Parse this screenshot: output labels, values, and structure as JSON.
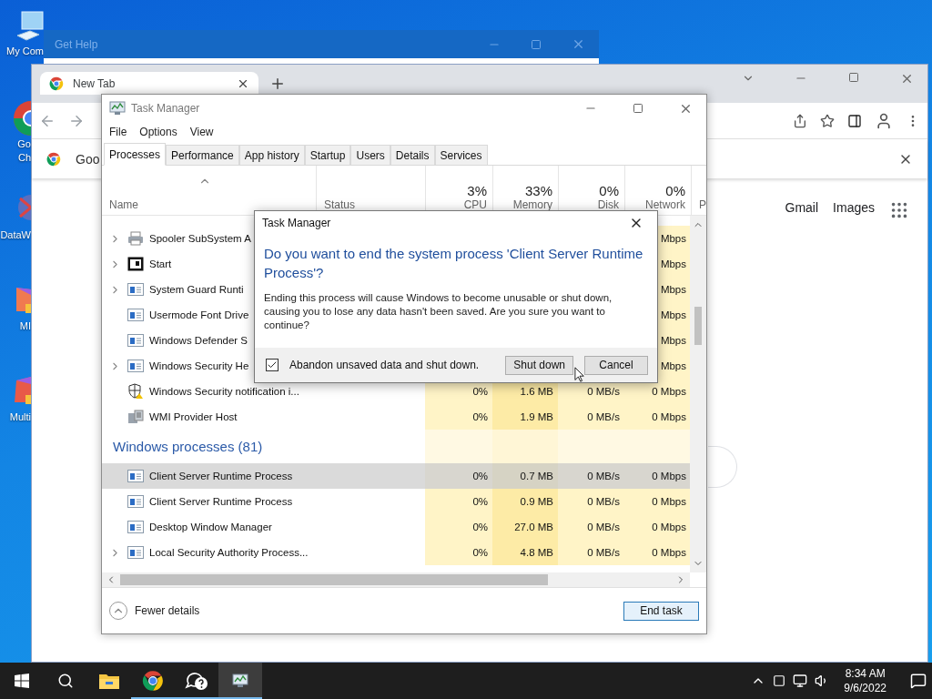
{
  "desktop": {
    "icons": [
      {
        "kind": "computer",
        "lines": [
          "My Com"
        ]
      },
      {
        "kind": "chrome",
        "lines": [
          "Go",
          "Ch"
        ]
      },
      {
        "kind": "dataw",
        "lines": [
          "DataW"
        ]
      },
      {
        "kind": "mi",
        "lines": [
          "MI"
        ]
      },
      {
        "kind": "multi",
        "lines": [
          "Multi"
        ]
      }
    ]
  },
  "get_help": {
    "title": "Get Help"
  },
  "browser": {
    "tab": {
      "title": "New Tab"
    },
    "infobar": {
      "text": "Goo"
    },
    "links": [
      "Gmail",
      "Images"
    ]
  },
  "task_manager": {
    "title": "Task Manager",
    "menu": [
      "File",
      "Options",
      "View"
    ],
    "tabs": [
      {
        "label": "Processes",
        "selected": true
      },
      {
        "label": "Performance",
        "selected": false
      },
      {
        "label": "App history",
        "selected": false
      },
      {
        "label": "Startup",
        "selected": false
      },
      {
        "label": "Users",
        "selected": false
      },
      {
        "label": "Details",
        "selected": false
      },
      {
        "label": "Services",
        "selected": false
      }
    ],
    "columns": [
      {
        "name": "Name"
      },
      {
        "name": "Status"
      },
      {
        "percent": "3%",
        "name": "CPU"
      },
      {
        "percent": "33%",
        "name": "Memory"
      },
      {
        "percent": "0%",
        "name": "Disk"
      },
      {
        "percent": "0%",
        "name": "Network"
      },
      {
        "name": "P"
      }
    ],
    "rows": [
      {
        "kind": "printer",
        "name": "Spooler SubSystem A",
        "expandable": true,
        "selected": false,
        "network": "Mbps"
      },
      {
        "kind": "start",
        "name": "Start",
        "expandable": true,
        "selected": false,
        "network": "Mbps"
      },
      {
        "kind": "app",
        "name": "System Guard Runti",
        "expandable": true,
        "selected": false,
        "network": "Mbps"
      },
      {
        "kind": "app",
        "name": "Usermode Font Drive",
        "expandable": false,
        "selected": false,
        "network": "Mbps"
      },
      {
        "kind": "app",
        "name": "Windows Defender S",
        "expandable": false,
        "selected": false,
        "network": "Mbps"
      },
      {
        "kind": "app",
        "name": "Windows Security He",
        "expandable": true,
        "selected": false,
        "network": "Mbps"
      },
      {
        "kind": "shield",
        "name": "Windows Security notification i...",
        "expandable": false,
        "selected": false,
        "cpu": "0%",
        "memory": "1.6 MB",
        "disk": "0 MB/s",
        "network": "0 Mbps"
      },
      {
        "kind": "wmi",
        "name": "WMI Provider Host",
        "expandable": false,
        "selected": false,
        "cpu": "0%",
        "memory": "1.9 MB",
        "disk": "0 MB/s",
        "network": "0 Mbps"
      },
      {
        "kind": "group",
        "label": "Windows processes (81)"
      },
      {
        "kind": "app",
        "name": "Client Server Runtime Process",
        "expandable": false,
        "selected": true,
        "cpu": "0%",
        "memory": "0.7 MB",
        "disk": "0 MB/s",
        "network": "0 Mbps"
      },
      {
        "kind": "app",
        "name": "Client Server Runtime Process",
        "expandable": false,
        "selected": false,
        "cpu": "0%",
        "memory": "0.9 MB",
        "disk": "0 MB/s",
        "network": "0 Mbps"
      },
      {
        "kind": "app",
        "name": "Desktop Window Manager",
        "expandable": false,
        "selected": false,
        "cpu": "0%",
        "memory": "27.0 MB",
        "disk": "0 MB/s",
        "network": "0 Mbps"
      },
      {
        "kind": "app",
        "name": "Local Security Authority Process...",
        "expandable": true,
        "selected": false,
        "cpu": "0%",
        "memory": "4.8 MB",
        "disk": "0 MB/s",
        "network": "0 Mbps"
      }
    ],
    "footer": {
      "toggle": "Fewer details",
      "button": "End task"
    }
  },
  "dialog": {
    "title": "Task Manager",
    "heading": "Do you want to end the system process 'Client Server Runtime Process'?",
    "body": "Ending this process will cause Windows to become unusable or shut down, causing you to lose any data hasn't been saved. Are you sure you want to continue?",
    "checkbox": {
      "label": "Abandon unsaved data and shut down.",
      "checked": true
    },
    "buttons": [
      "Shut down",
      "Cancel"
    ]
  },
  "taskbar": {
    "apps": [
      {
        "kind": "folder",
        "running": false,
        "selected": false
      },
      {
        "kind": "chrome",
        "running": true,
        "selected": false
      },
      {
        "kind": "help",
        "running": true,
        "selected": false
      },
      {
        "kind": "taskmgr",
        "running": true,
        "selected": true
      }
    ],
    "clock": {
      "time": "8:34 AM",
      "date": "9/6/2022"
    }
  }
}
